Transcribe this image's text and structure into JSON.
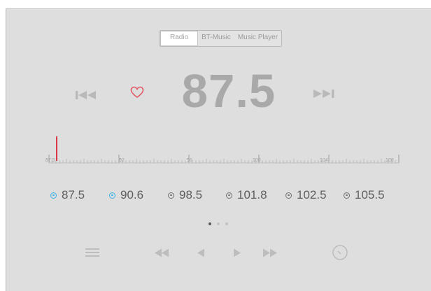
{
  "tabs": [
    {
      "label": "Radio",
      "active": true
    },
    {
      "label": "BT-Music",
      "active": false
    },
    {
      "label": "Music Player",
      "active": false
    }
  ],
  "frequency": "87.5",
  "icons": {
    "previous_station": "skip-previous-icon",
    "favorite": "heart-icon",
    "next_station": "skip-next-icon",
    "menu": "menu-icon",
    "rewind": "rewind-icon",
    "step_back": "step-back-icon",
    "step_forward": "step-forward-icon",
    "fast_forward": "fast-forward-icon",
    "tune": "tuner-dial-icon"
  },
  "tuner": {
    "scale_labels": [
      "87.5",
      "92",
      "96",
      "100",
      "104",
      "108"
    ],
    "min": 87.5,
    "max": 108,
    "current": 87.5
  },
  "presets": [
    {
      "label": "87.5",
      "active": true
    },
    {
      "label": "90.6",
      "active": true
    },
    {
      "label": "98.5",
      "active": false
    },
    {
      "label": "101.8",
      "active": false
    },
    {
      "label": "102.5",
      "active": false
    },
    {
      "label": "105.5",
      "active": false
    }
  ],
  "pager": {
    "pages": 3,
    "current": 1
  },
  "colors": {
    "background": "#dedede",
    "frequency_text": "#a9a9a9",
    "favorite_heart": "#e05a66",
    "tuner_needle": "#d9364a",
    "preset_active": "#3db0e8",
    "preset_inactive": "#707070"
  }
}
